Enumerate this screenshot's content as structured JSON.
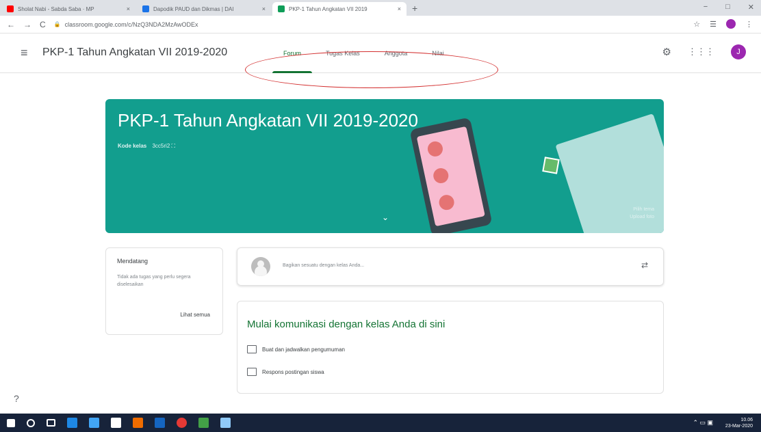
{
  "browser": {
    "tabs": [
      {
        "title": "Sholat Nabi - Sabda Saba · MP",
        "favicon_color": "#ff0000",
        "active": false
      },
      {
        "title": "Dapodik PAUD dan Dikmas | DAI",
        "favicon_color": "#1a73e8",
        "active": false
      },
      {
        "title": "PKP-1 Tahun Angkatan VII 2019",
        "favicon_color": "#0f9d58",
        "active": true
      }
    ],
    "url": "classroom.google.com/c/NzQ3NDA2MzAwODEx",
    "close_glyph": "×",
    "new_tab_glyph": "+",
    "back_glyph": "←",
    "forward_glyph": "→",
    "reload_glyph": "C",
    "lock_glyph": "🔒",
    "star_glyph": "☆",
    "menu_glyph": "⋮",
    "minimize_glyph": "−",
    "maximize_glyph": "□",
    "window_close_glyph": "✕"
  },
  "appbar": {
    "menu_glyph": "≡",
    "class_title": "PKP-1 Tahun Angkatan VII 2019-2020",
    "tabs": [
      "Forum",
      "Tugas Kelas",
      "Anggota",
      "Nilai"
    ],
    "active_tab": "Forum",
    "avatar_letter": "J",
    "accent_color": "#137333"
  },
  "banner": {
    "title": "PKP-1 Tahun Angkatan VII 2019-2020",
    "code_label": "Kode kelas",
    "code_value": "3cc5ri2",
    "pick_theme": "Pilih tema",
    "upload_photo": "Upload foto",
    "color": "#129e8e"
  },
  "upcoming": {
    "title": "Mendatang",
    "text": "Tidak ada tugas yang perlu segera diselesaikan",
    "view_all": "Lihat semua"
  },
  "share": {
    "placeholder": "Bagikan sesuatu dengan kelas Anda..."
  },
  "intro": {
    "title": "Mulai komunikasi dengan kelas Anda di sini",
    "items": [
      "Buat dan jadwalkan pengumuman",
      "Respons postingan siswa"
    ]
  },
  "taskbar": {
    "time": "10.06",
    "date": "23-Mar-2020"
  }
}
